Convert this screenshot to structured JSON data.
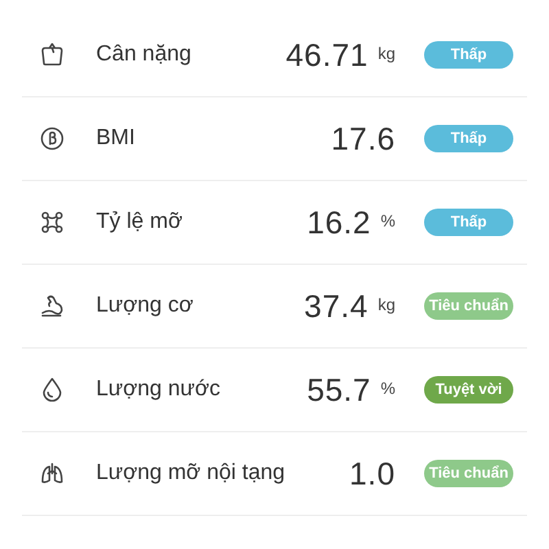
{
  "metrics": [
    {
      "kind": "scale",
      "label": "Cân nặng",
      "value": "46.71",
      "unit": "kg",
      "badge": "Thấp",
      "color": "#5bbcdb"
    },
    {
      "kind": "bmi",
      "label": "BMI",
      "value": "17.6",
      "badge": "Thấp",
      "color": "#5bbcdb"
    },
    {
      "kind": "fat",
      "label": "Tỷ lệ mỡ",
      "value": "16.2",
      "unit": "%",
      "badge": "Thấp",
      "color": "#5bbcdb"
    },
    {
      "kind": "muscle",
      "label": "Lượng cơ",
      "value": "37.4",
      "unit": "kg",
      "badge": "Tiêu chuẩn",
      "color": "#8ec98a"
    },
    {
      "kind": "water",
      "label": "Lượng nước",
      "value": "55.7",
      "unit": "%",
      "badge": "Tuyệt vời",
      "color": "#6fa84a"
    },
    {
      "kind": "lungs",
      "label": "Lượng mỡ nội tạng",
      "value": "1.0",
      "badge": "Tiêu chuẩn",
      "color": "#8ec98a"
    }
  ]
}
